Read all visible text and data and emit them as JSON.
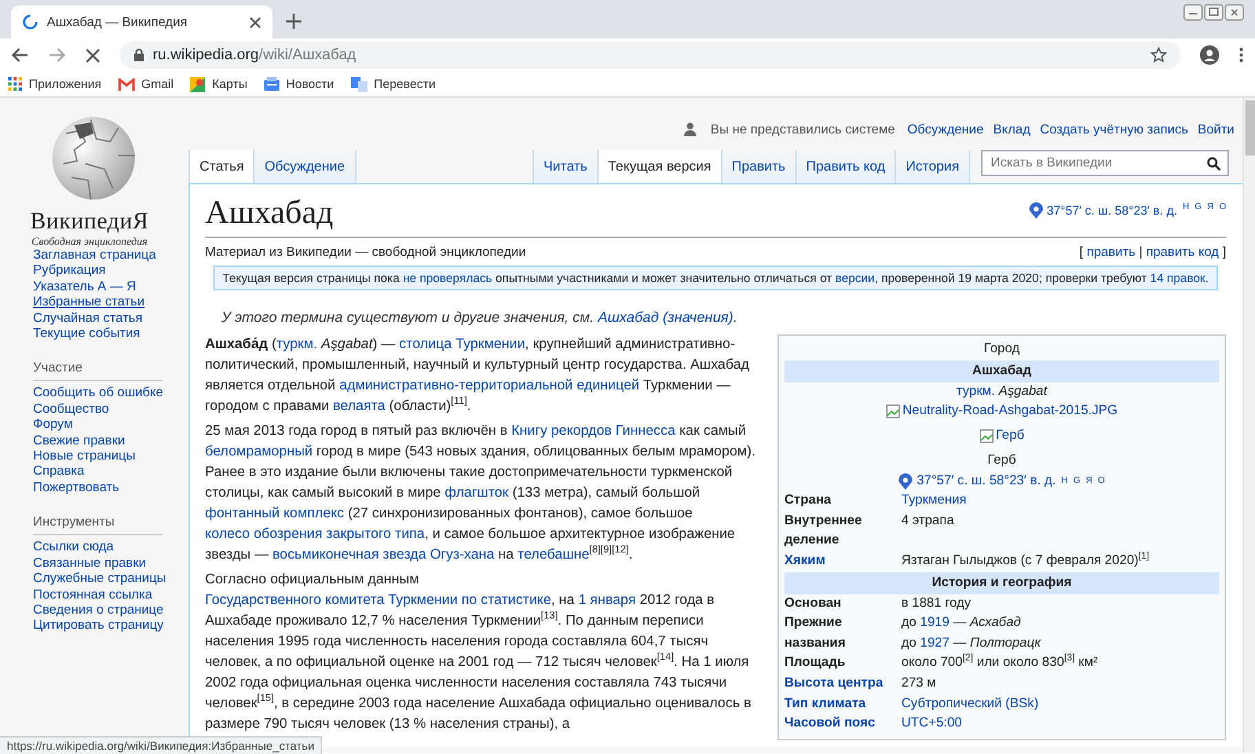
{
  "browser": {
    "tab_title": "Ашхабад — Википедия",
    "host": "ru.wikipedia.org",
    "path": "/wiki/Ашхабад",
    "bookmarks": [
      {
        "kind": "apps",
        "label": "Приложения"
      },
      {
        "kind": "gmail",
        "label": "Gmail"
      },
      {
        "kind": "maps",
        "label": "Карты"
      },
      {
        "kind": "news",
        "label": "Новости"
      },
      {
        "kind": "translate",
        "label": "Перевести"
      }
    ]
  },
  "sidebar": {
    "wordmark": "ВикипедиЯ",
    "tagline": "Свободная энциклопедия",
    "groups": [
      {
        "items": [
          {
            "label": "Заглавная страница",
            "hovered": false
          },
          {
            "label": "Рубрикация",
            "hovered": false
          },
          {
            "label": "Указатель А — Я",
            "hovered": false
          },
          {
            "label": "Избранные статьи",
            "hovered": true
          },
          {
            "label": "Случайная статья",
            "hovered": false
          },
          {
            "label": "Текущие события",
            "hovered": false
          }
        ]
      },
      {
        "heading": "Участие",
        "items": [
          {
            "label": "Сообщить об ошибке",
            "hovered": false
          },
          {
            "label": "Сообщество",
            "hovered": false
          },
          {
            "label": "Форум",
            "hovered": false
          },
          {
            "label": "Свежие правки",
            "hovered": false
          },
          {
            "label": "Новые страницы",
            "hovered": false
          },
          {
            "label": "Справка",
            "hovered": false
          },
          {
            "label": "Пожертвовать",
            "hovered": false
          }
        ]
      },
      {
        "heading": "Инструменты",
        "items": [
          {
            "label": "Ссылки сюда",
            "hovered": false
          },
          {
            "label": "Связанные правки",
            "hovered": false
          },
          {
            "label": "Служебные страницы",
            "hovered": false
          },
          {
            "label": "Постоянная ссылка",
            "hovered": false
          },
          {
            "label": "Сведения о странице",
            "hovered": false
          },
          {
            "label": "Цитировать страницу",
            "hovered": false
          }
        ]
      }
    ]
  },
  "personal": {
    "status": "Вы не представились системе",
    "links": [
      "Обсуждение",
      "Вклад",
      "Создать учётную запись",
      "Войти"
    ]
  },
  "tabs_left": [
    {
      "label": "Статья",
      "selected": true
    },
    {
      "label": "Обсуждение",
      "selected": false
    }
  ],
  "tabs_right": [
    {
      "label": "Читать",
      "selected": false
    },
    {
      "label": "Текущая версия",
      "selected": true
    },
    {
      "label": "Править",
      "selected": false
    },
    {
      "label": "Править код",
      "selected": false
    },
    {
      "label": "История",
      "selected": false
    }
  ],
  "search": {
    "placeholder": "Искать в Википедии"
  },
  "article": {
    "title": "Ашхабад",
    "coords": {
      "text": "37°57′ с. ш. 58°23′ в. д.",
      "links": [
        "H",
        "G",
        "Я",
        "O"
      ]
    },
    "tagline": "Материал из Википедии — свободной энциклопедии",
    "edit_links": [
      {
        "t": "[ "
      },
      {
        "t": "править",
        "link": true
      },
      {
        "t": " | "
      },
      {
        "t": "править код",
        "link": true
      },
      {
        "t": " ]"
      }
    ],
    "notice": [
      {
        "t": "Текущая версия страницы пока "
      },
      {
        "t": "не проверялась",
        "link": true
      },
      {
        "t": " опытными участниками и может значительно отличаться от "
      },
      {
        "t": "версии",
        "link": true
      },
      {
        "t": ", проверенной 19 марта 2020; проверки требуют "
      },
      {
        "t": "14 правок",
        "link": true
      },
      {
        "t": "."
      }
    ],
    "hatnote": [
      {
        "t": "У этого термина существуют и другие значения, см. "
      },
      {
        "t": "Ашхабад (значения)",
        "link": true
      },
      {
        "t": "."
      }
    ],
    "paragraphs": [
      [
        {
          "t": "**Ашхаба́д** ("
        },
        {
          "t": "туркм.",
          "link": true
        },
        {
          "t": " *Aşgabat*) — "
        },
        {
          "t": "столица Туркмении",
          "link": true
        },
        {
          "t": ", крупнейший административно-политический, промышленный, научный и культурный центр государства. Ашхабад является отдельной "
        },
        {
          "t": "административно-территориальной единицей",
          "link": true
        },
        {
          "t": " Туркмении — городом с правами "
        },
        {
          "t": "велаята",
          "link": true
        },
        {
          "t": " (области)$^{[11]}$."
        }
      ],
      [
        {
          "t": "25 мая 2013 года город в пятый раз включён в "
        },
        {
          "t": "Книгу рекордов Гиннесса",
          "link": true
        },
        {
          "t": " как самый "
        },
        {
          "t": "беломраморный",
          "link": true
        },
        {
          "t": " город в мире (543 новых здания, облицованных белым мрамором). Ранее в это издание были включены такие достопримечательности туркменской столицы, как самый высокий в мире "
        },
        {
          "t": "флагшток",
          "link": true
        },
        {
          "t": " (133 метра), самый большой "
        },
        {
          "t": "фонтанный комплекс",
          "link": true
        },
        {
          "t": " (27 синхронизированных фонтанов), самое большое "
        },
        {
          "t": "колесо обозрения закрытого типа",
          "link": true
        },
        {
          "t": ", и самое большое архитектурное изображение звезды — "
        },
        {
          "t": "восьмиконечная звезда Огуз-хана",
          "link": true
        },
        {
          "t": " на "
        },
        {
          "t": "телебашне",
          "link": true
        },
        {
          "t": "$^{[8][9][12]}$."
        }
      ],
      [
        {
          "t": "Согласно официальным данным "
        },
        {
          "t": "Государственного комитета Туркмении по статистике",
          "link": true
        },
        {
          "t": ", на "
        },
        {
          "t": "1 января",
          "link": true
        },
        {
          "t": " 2012 года в Ашхабаде проживало 12,7 % населения Туркмении$^{[13]}$. По данным переписи населения 1995 года численность населения города составляла 604,7 тысяч человек, а по официальной оценке на 2001 год — 712 тысяч человек$^{[14]}$. На 1 июля 2002 года официальная оценка численности населения составляла 743 тысячи человек$^{[15]}$, в середине 2003 года население Ашхабада официально оценивалось в размере 790 тысяч человек (13 % населения страны), а"
        }
      ]
    ]
  },
  "infobox": [
    {
      "kind": "caption",
      "text": "Город"
    },
    {
      "kind": "title",
      "text": "Ашхабад"
    },
    {
      "kind": "text",
      "segs": [
        {
          "t": "туркм.",
          "link": true
        },
        {
          "t": " *Aşgabat*"
        }
      ]
    },
    {
      "kind": "image",
      "alt": "Neutrality-Road-Ashgabat-2015.JPG"
    },
    {
      "kind": "image",
      "alt": "Герб"
    },
    {
      "kind": "text",
      "segs": [
        {
          "t": "Герб"
        }
      ]
    },
    {
      "kind": "coords",
      "text": "37°57′ с. ш. 58°23′ в. д.",
      "links": [
        "H",
        "G",
        "Я",
        "O"
      ]
    },
    {
      "kind": "row",
      "label": "Страна",
      "label_link": false,
      "lines": [
        [
          {
            "t": "Туркмения",
            "link": true
          }
        ]
      ]
    },
    {
      "kind": "row",
      "label": "Внутреннее деление",
      "label_link": false,
      "lines": [
        [
          {
            "t": "4 этрапа"
          }
        ]
      ]
    },
    {
      "kind": "row",
      "label": "Хяким",
      "label_link": true,
      "lines": [
        [
          {
            "t": "Язтаган Гылыджов (с 7 февраля 2020)$^{[1]}$"
          }
        ]
      ]
    },
    {
      "kind": "section",
      "text": "История и география"
    },
    {
      "kind": "row",
      "label": "Основан",
      "label_link": false,
      "lines": [
        [
          {
            "t": "в 1881 году"
          }
        ]
      ]
    },
    {
      "kind": "row",
      "label": "Прежние названия",
      "label_link": false,
      "lines": [
        [
          {
            "t": "до "
          },
          {
            "t": "1919",
            "link": true
          },
          {
            "t": " — *Асхабад*"
          }
        ],
        [
          {
            "t": "до "
          },
          {
            "t": "1927",
            "link": true
          },
          {
            "t": " — *Полторацк*"
          }
        ]
      ]
    },
    {
      "kind": "row",
      "label": "Площадь",
      "label_link": false,
      "lines": [
        [
          {
            "t": "около 700$^{[2]}$ или около 830$^{[3]}$ км²"
          }
        ]
      ]
    },
    {
      "kind": "row",
      "label": "Высота центра",
      "label_link": true,
      "lines": [
        [
          {
            "t": "273 м"
          }
        ]
      ]
    },
    {
      "kind": "row",
      "label": "Тип климата",
      "label_link": true,
      "lines": [
        [
          {
            "t": "Субтропический (BSk)",
            "link": true
          }
        ]
      ]
    },
    {
      "kind": "row",
      "label": "Часовой пояс",
      "label_link": true,
      "lines": [
        [
          {
            "t": "UTC+5:00",
            "link": true
          }
        ]
      ]
    }
  ],
  "status_url": "https://ru.wikipedia.org/wiki/Википедия:Избранные_статьи"
}
